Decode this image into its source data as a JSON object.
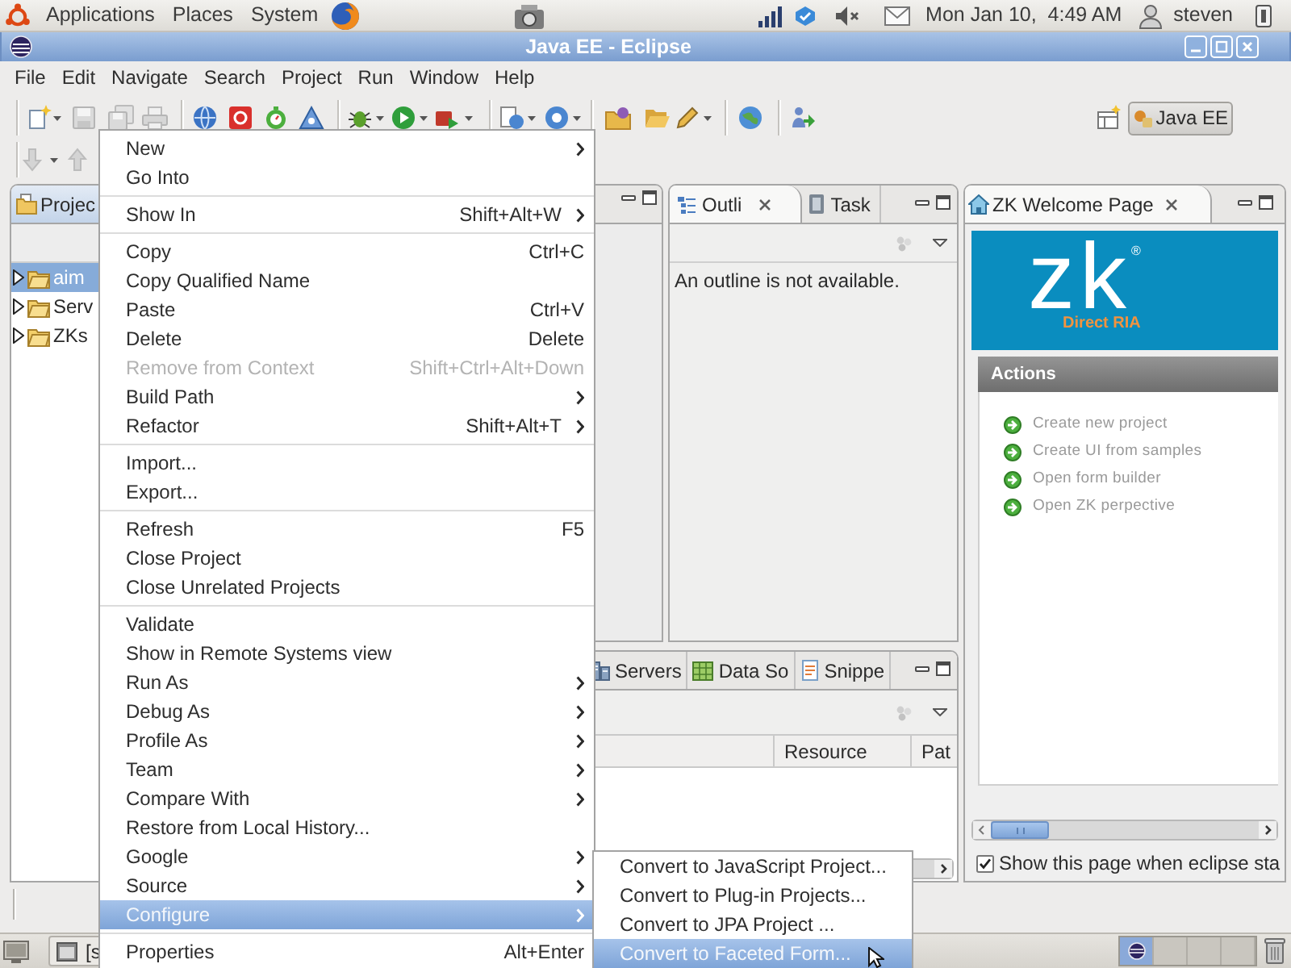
{
  "top_panel": {
    "menus": [
      "Applications",
      "Places",
      "System"
    ],
    "clock": "Mon Jan 10,  4:49 AM",
    "user": "steven"
  },
  "window": {
    "title": "Java EE - Eclipse"
  },
  "menu_bar": [
    "File",
    "Edit",
    "Navigate",
    "Search",
    "Project",
    "Run",
    "Window",
    "Help"
  ],
  "perspectives": [
    {
      "label": "Java EE",
      "selected": true
    }
  ],
  "project_explorer": {
    "tab": {
      "label": "Projec",
      "selected": true
    },
    "tree": [
      {
        "label": "aim",
        "selected": true,
        "expanded": false
      },
      {
        "label": "Serv",
        "selected": false,
        "expanded": false
      },
      {
        "label": "ZKs",
        "selected": false,
        "expanded": false
      }
    ]
  },
  "outline": {
    "tabs": [
      {
        "label": "Outli",
        "selected": true
      },
      {
        "label": "Task",
        "selected": false
      }
    ],
    "message": "An outline is not available."
  },
  "bottom_panel": {
    "tabs": [
      {
        "label": "Servers",
        "selected": false
      },
      {
        "label": "Data So",
        "selected": false
      },
      {
        "label": "Snippe",
        "selected": false
      }
    ],
    "columns": [
      "Resource",
      "Pat"
    ]
  },
  "welcome": {
    "tab": {
      "label": "ZK Welcome Page",
      "selected": true
    },
    "logo": {
      "mark": "zk",
      "registered": "®",
      "tagline": "Direct RIA"
    },
    "section_title": "Actions",
    "actions": [
      "Create new project",
      "Create UI from samples",
      "Open form builder",
      "Open ZK perpective"
    ],
    "show_on_startup": {
      "label": "Show this page when eclipse sta",
      "checked": true
    }
  },
  "taskbar": {
    "window_label": "[s",
    "workspaces": [
      {
        "selected": true
      },
      {
        "selected": false
      },
      {
        "selected": false
      },
      {
        "selected": false
      }
    ]
  },
  "context_menu": {
    "items": [
      {
        "kind": "item",
        "label": "New",
        "submenu": true,
        "disabled": false,
        "selected": false
      },
      {
        "kind": "item",
        "label": "Go Into",
        "submenu": false,
        "disabled": false,
        "selected": false
      },
      {
        "kind": "separator"
      },
      {
        "kind": "item",
        "label": "Show In",
        "shortcut": "Shift+Alt+W",
        "submenu": true,
        "disabled": false,
        "selected": false
      },
      {
        "kind": "separator"
      },
      {
        "kind": "item",
        "label": "Copy",
        "shortcut": "Ctrl+C",
        "submenu": false,
        "disabled": false,
        "selected": false
      },
      {
        "kind": "item",
        "label": "Copy Qualified Name",
        "submenu": false,
        "disabled": false,
        "selected": false
      },
      {
        "kind": "item",
        "label": "Paste",
        "shortcut": "Ctrl+V",
        "submenu": false,
        "disabled": false,
        "selected": false
      },
      {
        "kind": "item",
        "label": "Delete",
        "shortcut": "Delete",
        "submenu": false,
        "disabled": false,
        "selected": false
      },
      {
        "kind": "item",
        "label": "Remove from Context",
        "shortcut": "Shift+Ctrl+Alt+Down",
        "submenu": false,
        "disabled": true,
        "selected": false
      },
      {
        "kind": "item",
        "label": "Build Path",
        "submenu": true,
        "disabled": false,
        "selected": false
      },
      {
        "kind": "item",
        "label": "Refactor",
        "shortcut": "Shift+Alt+T",
        "submenu": true,
        "disabled": false,
        "selected": false
      },
      {
        "kind": "separator"
      },
      {
        "kind": "item",
        "label": "Import...",
        "submenu": false,
        "disabled": false,
        "selected": false
      },
      {
        "kind": "item",
        "label": "Export...",
        "submenu": false,
        "disabled": false,
        "selected": false
      },
      {
        "kind": "separator"
      },
      {
        "kind": "item",
        "label": "Refresh",
        "shortcut": "F5",
        "submenu": false,
        "disabled": false,
        "selected": false
      },
      {
        "kind": "item",
        "label": "Close Project",
        "submenu": false,
        "disabled": false,
        "selected": false
      },
      {
        "kind": "item",
        "label": "Close Unrelated Projects",
        "submenu": false,
        "disabled": false,
        "selected": false
      },
      {
        "kind": "separator"
      },
      {
        "kind": "item",
        "label": "Validate",
        "submenu": false,
        "disabled": false,
        "selected": false
      },
      {
        "kind": "item",
        "label": "Show in Remote Systems view",
        "submenu": false,
        "disabled": false,
        "selected": false
      },
      {
        "kind": "item",
        "label": "Run As",
        "submenu": true,
        "disabled": false,
        "selected": false
      },
      {
        "kind": "item",
        "label": "Debug As",
        "submenu": true,
        "disabled": false,
        "selected": false
      },
      {
        "kind": "item",
        "label": "Profile As",
        "submenu": true,
        "disabled": false,
        "selected": false
      },
      {
        "kind": "item",
        "label": "Team",
        "submenu": true,
        "disabled": false,
        "selected": false
      },
      {
        "kind": "item",
        "label": "Compare With",
        "submenu": true,
        "disabled": false,
        "selected": false
      },
      {
        "kind": "item",
        "label": "Restore from Local History...",
        "submenu": false,
        "disabled": false,
        "selected": false
      },
      {
        "kind": "item",
        "label": "Google",
        "submenu": true,
        "disabled": false,
        "selected": false
      },
      {
        "kind": "item",
        "label": "Source",
        "submenu": true,
        "disabled": false,
        "selected": false
      },
      {
        "kind": "item",
        "label": "Configure",
        "submenu": true,
        "disabled": false,
        "selected": true
      },
      {
        "kind": "separator"
      },
      {
        "kind": "item",
        "label": "Properties",
        "shortcut": "Alt+Enter",
        "submenu": false,
        "disabled": false,
        "selected": false
      }
    ]
  },
  "submenu": {
    "items": [
      {
        "label": "Convert to JavaScript Project...",
        "selected": false
      },
      {
        "label": "Convert to Plug-in Projects...",
        "selected": false
      },
      {
        "label": "Convert to JPA Project ...",
        "selected": false
      },
      {
        "label": "Convert to Faceted Form...",
        "selected": true
      }
    ]
  }
}
